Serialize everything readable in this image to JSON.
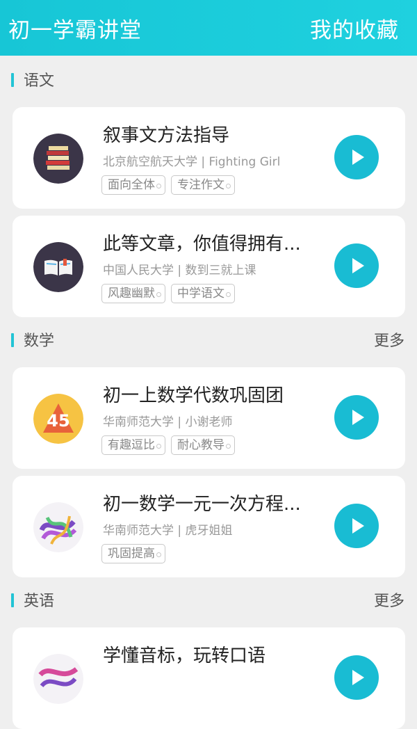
{
  "header": {
    "title": "初一学霸讲堂",
    "favorites": "我的收藏"
  },
  "sections": [
    {
      "name": "语文",
      "more": "",
      "cards": [
        {
          "title": "叙事文方法指导",
          "meta": "北京航空航天大学 | Fighting Girl",
          "tags": [
            "面向全体",
            "专注作文"
          ],
          "icon": "books-icon"
        },
        {
          "title": "此等文章，你值得拥有...",
          "meta": "中国人民大学 | 数到三就上课",
          "tags": [
            "风趣幽默",
            "中学语文"
          ],
          "icon": "open-book-icon"
        }
      ]
    },
    {
      "name": "数学",
      "more": "更多",
      "cards": [
        {
          "title": "初一上数学代数巩固团",
          "meta": "华南师范大学 | 小谢老师",
          "tags": [
            "有趣逗比",
            "耐心教导"
          ],
          "icon": "number-45-icon"
        },
        {
          "title": "初一数学一元一次方程...",
          "meta": "华南师范大学 | 虎牙姐姐",
          "tags": [
            "巩固提高"
          ],
          "icon": "colorful-abstract-avatar"
        }
      ]
    },
    {
      "name": "英语",
      "more": "更多",
      "cards": [
        {
          "title": "学懂音标，玩转口语",
          "meta": "",
          "tags": [],
          "icon": "colorful-abstract-avatar"
        }
      ]
    }
  ],
  "avatar_text": {
    "math1": "45"
  },
  "colors": {
    "accent": "#19bcd3",
    "header": "#17c6d6",
    "background": "#efefef"
  }
}
